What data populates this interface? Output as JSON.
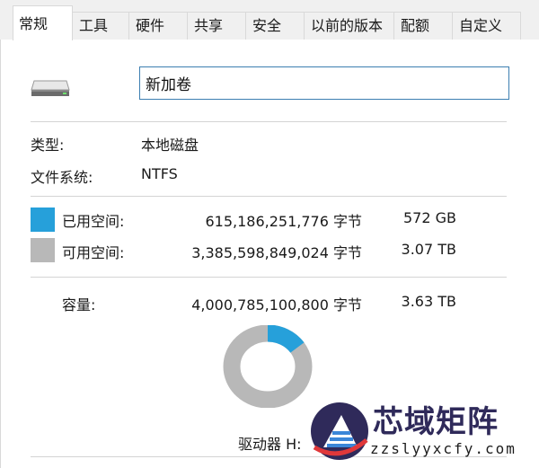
{
  "tabs": [
    {
      "label": "常规",
      "active": true
    },
    {
      "label": "工具"
    },
    {
      "label": "硬件"
    },
    {
      "label": "共享"
    },
    {
      "label": "安全"
    },
    {
      "label": "以前的版本"
    },
    {
      "label": "配额"
    },
    {
      "label": "自定义"
    }
  ],
  "drive": {
    "name_value": "新加卷",
    "icon": "hard-drive-icon"
  },
  "info": {
    "type_label": "类型:",
    "type_value": "本地磁盘",
    "fs_label": "文件系统:",
    "fs_value": "NTFS"
  },
  "space": {
    "used_label": "已用空间:",
    "used_bytes": "615,186,251,776 字节",
    "used_size": "572 GB",
    "used_color": "#26a0da",
    "free_label": "可用空间:",
    "free_bytes": "3,385,598,849,024 字节",
    "free_size": "3.07 TB",
    "free_color": "#b8b8b8",
    "capacity_label": "容量:",
    "capacity_bytes": "4,000,785,100,800 字节",
    "capacity_size": "3.63 TB",
    "used_fraction": 0.1538
  },
  "drive_label": "驱动器 H:",
  "watermark": {
    "title": "芯域矩阵",
    "url": "zzslyyxcfy.com"
  }
}
